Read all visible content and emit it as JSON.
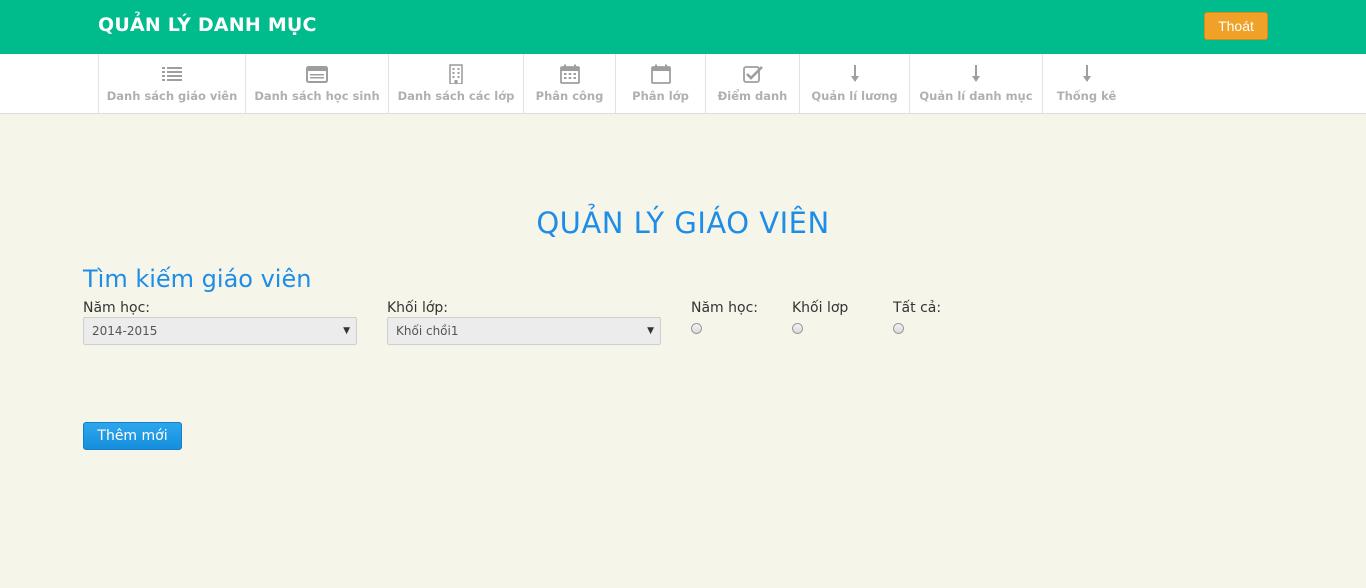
{
  "header": {
    "title": "QUẢN LÝ DANH MỤC",
    "logout_label": "Thoát",
    "bar_color": "#00bb8c",
    "logout_color": "#f0a128"
  },
  "nav": {
    "items": [
      {
        "label": "Danh sách giáo viên",
        "icon": "list-icon"
      },
      {
        "label": "Danh sách học sinh",
        "icon": "id-card-icon"
      },
      {
        "label": "Danh sách các lớp",
        "icon": "building-icon"
      },
      {
        "label": "Phân công",
        "icon": "calendar-icon"
      },
      {
        "label": "Phân lớp",
        "icon": "calendar-empty-icon"
      },
      {
        "label": "Điểm danh",
        "icon": "checkbox-icon"
      },
      {
        "label": "Quản lí lương",
        "icon": "arrow-down-icon"
      },
      {
        "label": "Quản lí danh mục",
        "icon": "arrow-down-icon"
      },
      {
        "label": "Thống kê",
        "icon": "arrow-down-icon"
      }
    ]
  },
  "main": {
    "page_title": "QUẢN LÝ GIÁO VIÊN",
    "search_title": "Tìm kiếm giáo viên",
    "year_label": "Năm học:",
    "year_value": "2014-2015",
    "grade_label": "Khối lớp:",
    "grade_value": "Khối chồi1",
    "radio_options": [
      "Năm học:",
      "Khối lơp",
      "Tất cả:"
    ],
    "add_button": "Thêm mới",
    "accent_color": "#1e8de8"
  }
}
